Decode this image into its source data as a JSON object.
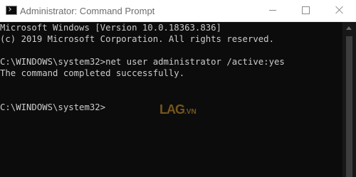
{
  "window": {
    "title": "Administrator: Command Prompt",
    "minimize_icon": "minimize-icon",
    "maximize_icon": "maximize-icon",
    "close_icon": "close-icon"
  },
  "console": {
    "lines": [
      "Microsoft Windows [Version 10.0.18363.836]",
      "(c) 2019 Microsoft Corporation. All rights reserved.",
      "C:\\WINDOWS\\system32>net user administrator /active:yes",
      "The command completed successfully.",
      "C:\\WINDOWS\\system32>"
    ],
    "background": "#0c0c0c",
    "foreground": "#cccccc"
  },
  "watermark": {
    "text": "LAG",
    "suffix": ".VN"
  }
}
